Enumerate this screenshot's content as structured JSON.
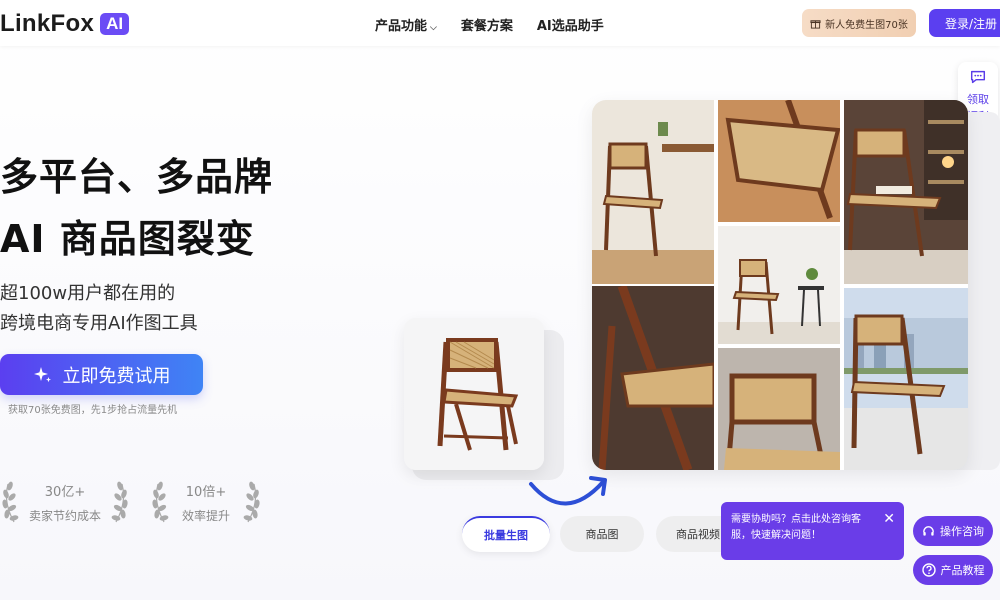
{
  "header": {
    "logo_text": "LinkFox",
    "logo_badge": "AI",
    "nav": [
      {
        "label": "产品功能",
        "has_dropdown": true
      },
      {
        "label": "套餐方案",
        "has_dropdown": false
      },
      {
        "label": "AI选品助手",
        "has_dropdown": false
      }
    ],
    "promo_label": "新人免费生图70张",
    "login_label": "登录/注册"
  },
  "hero": {
    "title_line1": "多平台、多品牌",
    "title_line2": "AI 商品图裂变",
    "subtitle_line1": "超100w用户都在用的",
    "subtitle_line2": "跨境电商专用AI作图工具",
    "cta_label": "立即免费试用",
    "cta_note": "获取70张免费图，先1步抢占流量先机"
  },
  "stats": [
    {
      "value": "30亿+",
      "label": "卖家节约成本"
    },
    {
      "value": "10倍+",
      "label": "效率提升"
    }
  ],
  "tabs": [
    {
      "label": "批量生图",
      "active": true
    },
    {
      "label": "商品图",
      "active": false
    },
    {
      "label": "商品视频",
      "active": false
    }
  ],
  "support": {
    "chat_message": "需要协助吗？点击此处咨询客服，快速解决问题！",
    "consult_label": "操作咨询",
    "tutorial_label": "产品教程",
    "welfare_line1": "领取",
    "welfare_line2": "福利"
  },
  "colors": {
    "brand_purple": "#5b3ff0",
    "chat_purple": "#6a3de8",
    "cta_gradient_end": "#3f84f5"
  },
  "icons": {
    "cta": "sparkle-icon",
    "promo": "gift-icon",
    "consult": "headset-icon",
    "tutorial": "question-icon",
    "welfare": "chat-bubble-icon",
    "close": "close-icon"
  }
}
